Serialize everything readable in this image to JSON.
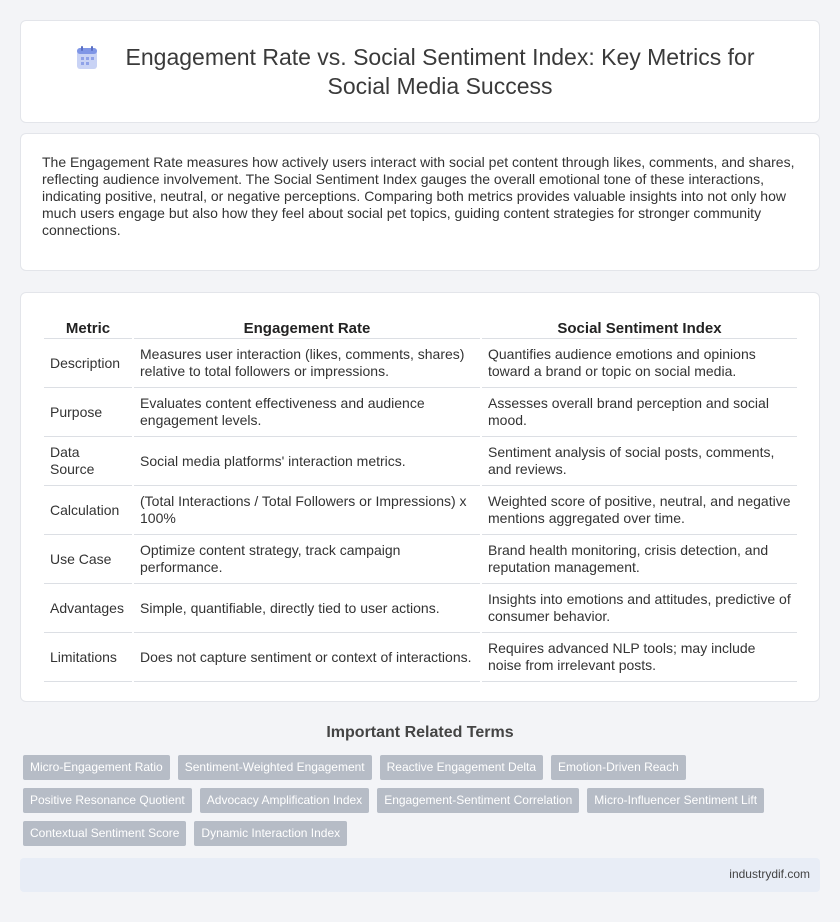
{
  "header": {
    "title": "Engagement Rate vs. Social Sentiment Index: Key Metrics for Social Media Success",
    "icon": "document-icon"
  },
  "intro": {
    "text": "The Engagement Rate measures how actively users interact with social pet content through likes, comments, and shares, reflecting audience involvement. The Social Sentiment Index gauges the overall emotional tone of these interactions, indicating positive, neutral, or negative perceptions. Comparing both metrics provides valuable insights into not only how much users engage but also how they feel about social pet topics, guiding content strategies for stronger community connections."
  },
  "table": {
    "headers": [
      "Metric",
      "Engagement Rate",
      "Social Sentiment Index"
    ],
    "rows": [
      [
        "Description",
        "Measures user interaction (likes, comments, shares) relative to total followers or impressions.",
        "Quantifies audience emotions and opinions toward a brand or topic on social media."
      ],
      [
        "Purpose",
        "Evaluates content effectiveness and audience engagement levels.",
        "Assesses overall brand perception and social mood."
      ],
      [
        "Data Source",
        "Social media platforms' interaction metrics.",
        "Sentiment analysis of social posts, comments, and reviews."
      ],
      [
        "Calculation",
        "(Total Interactions / Total Followers or Impressions) x 100%",
        "Weighted score of positive, neutral, and negative mentions aggregated over time."
      ],
      [
        "Use Case",
        "Optimize content strategy, track campaign performance.",
        "Brand health monitoring, crisis detection, and reputation management."
      ],
      [
        "Advantages",
        "Simple, quantifiable, directly tied to user actions.",
        "Insights into emotions and attitudes, predictive of consumer behavior."
      ],
      [
        "Limitations",
        "Does not capture sentiment or context of interactions.",
        "Requires advanced NLP tools; may include noise from irrelevant posts."
      ]
    ]
  },
  "related": {
    "title": "Important Related Terms",
    "tags": [
      "Micro-Engagement Ratio",
      "Sentiment-Weighted Engagement",
      "Reactive Engagement Delta",
      "Emotion-Driven Reach",
      "Positive Resonance Quotient",
      "Advocacy Amplification Index",
      "Engagement-Sentiment Correlation",
      "Micro-Influencer Sentiment Lift",
      "Contextual Sentiment Score",
      "Dynamic Interaction Index"
    ]
  },
  "footer": {
    "site": "industrydif.com"
  },
  "colors": {
    "tag_bg": "#b6bcc6",
    "footer_bg": "#e8edf6",
    "page_bg": "#f3f4f7"
  }
}
